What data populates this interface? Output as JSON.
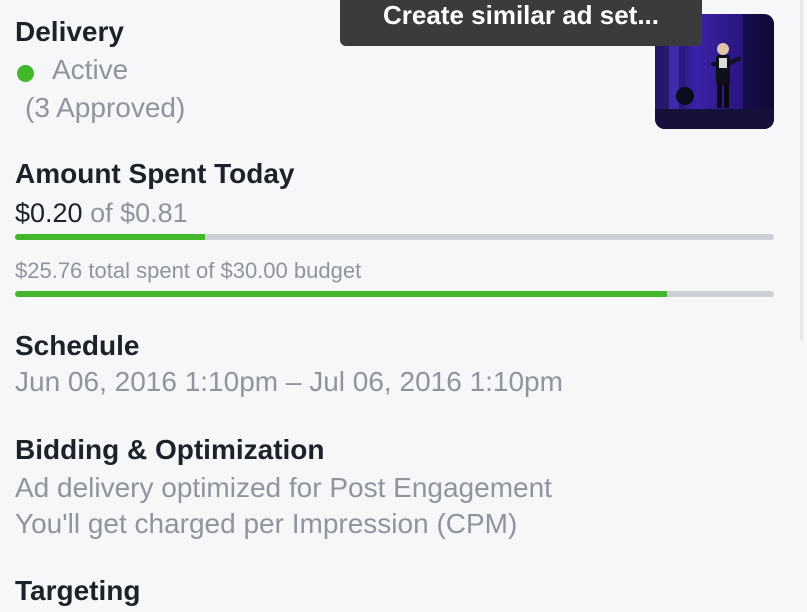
{
  "tooltip": {
    "label": "Create similar ad set..."
  },
  "delivery": {
    "heading": "Delivery",
    "status": "Active",
    "approved": "(3 Approved)"
  },
  "amount_spent": {
    "heading": "Amount Spent Today",
    "spent": "$0.20",
    "of_label": "of $0.81",
    "today_progress": 0.25,
    "total_line": "$25.76 total spent of $30.00 budget",
    "total_progress": 0.8587
  },
  "schedule": {
    "heading": "Schedule",
    "range": "Jun 06, 2016 1:10pm – Jul 06, 2016 1:10pm"
  },
  "bidding": {
    "heading": "Bidding & Optimization",
    "line1": "Ad delivery optimized for Post Engagement",
    "line2": "You'll get charged per Impression (CPM)"
  },
  "targeting": {
    "heading": "Targeting"
  },
  "colors": {
    "accent_green": "#42b72a",
    "track_gray": "#ccd0d5",
    "muted_text": "#90949c",
    "heading_text": "#1d2129",
    "tooltip_bg": "#3a3b3c"
  },
  "icons": {
    "thumbnail": "ad-creative-thumbnail"
  }
}
